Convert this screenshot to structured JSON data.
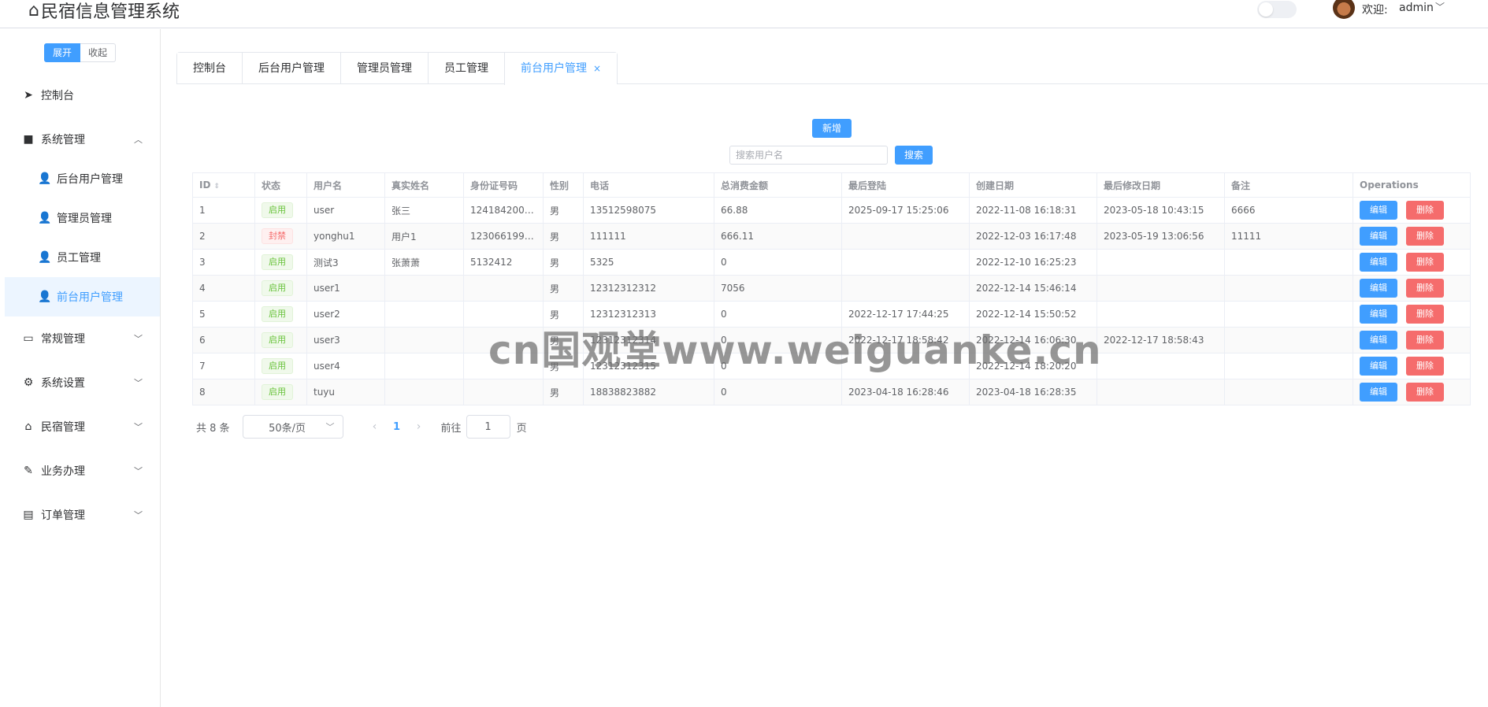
{
  "header": {
    "title": "民宿信息管理系统",
    "home_icon": "⌂",
    "welcome": "欢迎:",
    "user": "admin",
    "caret": "﹀"
  },
  "sidebar": {
    "expand": "展开",
    "collapse": "收起",
    "items": [
      {
        "label": "控制台",
        "icon": "➤"
      },
      {
        "label": "系统管理",
        "icon": "■",
        "arrow": "︿"
      },
      {
        "label": "后台用户管理",
        "icon": "👤"
      },
      {
        "label": "管理员管理",
        "icon": "👤"
      },
      {
        "label": "员工管理",
        "icon": "👤"
      },
      {
        "label": "前台用户管理",
        "icon": "👤"
      },
      {
        "label": "常规管理",
        "icon": "▭",
        "arrow": "﹀"
      },
      {
        "label": "系统设置",
        "icon": "⚙",
        "arrow": "﹀"
      },
      {
        "label": "民宿管理",
        "icon": "⌂",
        "arrow": "﹀"
      },
      {
        "label": "业务办理",
        "icon": "✎",
        "arrow": "﹀"
      },
      {
        "label": "订单管理",
        "icon": "▤",
        "arrow": "﹀"
      }
    ]
  },
  "tabs": [
    "控制台",
    "后台用户管理",
    "管理员管理",
    "员工管理",
    "前台用户管理"
  ],
  "tab_close": "×",
  "toolbar": {
    "add": "新增",
    "search_placeholder": "搜索用户名",
    "search": "搜索"
  },
  "table": {
    "columns": [
      "ID",
      "状态",
      "用户名",
      "真实姓名",
      "身份证号码",
      "性别",
      "电话",
      "总消费金额",
      "最后登陆",
      "创建日期",
      "最后修改日期",
      "备注",
      "Operations"
    ],
    "sort_icon": "⇕",
    "edit": "编辑",
    "delete": "删除",
    "rows": [
      {
        "id": "1",
        "status": "启用",
        "status_type": "ok",
        "username": "user",
        "realname": "张三",
        "idcard": "1241842009…",
        "gender": "男",
        "phone": "13512598075",
        "spent": "66.88",
        "last_login": "2025-09-17 15:25:06",
        "created": "2022-11-08 16:18:31",
        "modified": "2023-05-18 10:43:15",
        "note": "6666"
      },
      {
        "id": "2",
        "status": "封禁",
        "status_type": "ban",
        "username": "yonghu1",
        "realname": "用户1",
        "idcard": "1230661994…",
        "gender": "男",
        "phone": "111111",
        "spent": "666.11",
        "last_login": "",
        "created": "2022-12-03 16:17:48",
        "modified": "2023-05-19 13:06:56",
        "note": "11111"
      },
      {
        "id": "3",
        "status": "启用",
        "status_type": "ok",
        "username": "测试3",
        "realname": "张萧萧",
        "idcard": "5132412",
        "gender": "男",
        "phone": "5325",
        "spent": "0",
        "last_login": "",
        "created": "2022-12-10 16:25:23",
        "modified": "",
        "note": ""
      },
      {
        "id": "4",
        "status": "启用",
        "status_type": "ok",
        "username": "user1",
        "realname": "",
        "idcard": "",
        "gender": "男",
        "phone": "12312312312",
        "spent": "7056",
        "last_login": "",
        "created": "2022-12-14 15:46:14",
        "modified": "",
        "note": ""
      },
      {
        "id": "5",
        "status": "启用",
        "status_type": "ok",
        "username": "user2",
        "realname": "",
        "idcard": "",
        "gender": "男",
        "phone": "12312312313",
        "spent": "0",
        "last_login": "2022-12-17 17:44:25",
        "created": "2022-12-14 15:50:52",
        "modified": "",
        "note": ""
      },
      {
        "id": "6",
        "status": "启用",
        "status_type": "ok",
        "username": "user3",
        "realname": "",
        "idcard": "",
        "gender": "男",
        "phone": "12312312314",
        "spent": "0",
        "last_login": "2022-12-17 18:58:42",
        "created": "2022-12-14 16:06:30",
        "modified": "2022-12-17 18:58:43",
        "note": ""
      },
      {
        "id": "7",
        "status": "启用",
        "status_type": "ok",
        "username": "user4",
        "realname": "",
        "idcard": "",
        "gender": "男",
        "phone": "12312312315",
        "spent": "0",
        "last_login": "",
        "created": "2022-12-14 18:20:20",
        "modified": "",
        "note": ""
      },
      {
        "id": "8",
        "status": "启用",
        "status_type": "ok",
        "username": "tuyu",
        "realname": "",
        "idcard": "",
        "gender": "男",
        "phone": "18838823882",
        "spent": "0",
        "last_login": "2023-04-18 16:28:46",
        "created": "2023-04-18 16:28:35",
        "modified": "",
        "note": ""
      }
    ]
  },
  "pagination": {
    "total": "共 8 条",
    "page_size": "50条/页",
    "prev": "‹",
    "page": "1",
    "next": "›",
    "goto": "前往",
    "goto_value": "1",
    "page_unit": "页",
    "select_caret": "﹀"
  },
  "watermark": "cn国观堂www.weiguanke.cn",
  "colors": {
    "primary": "#409eff",
    "danger": "#f56c6c",
    "success": "#67c23a"
  }
}
